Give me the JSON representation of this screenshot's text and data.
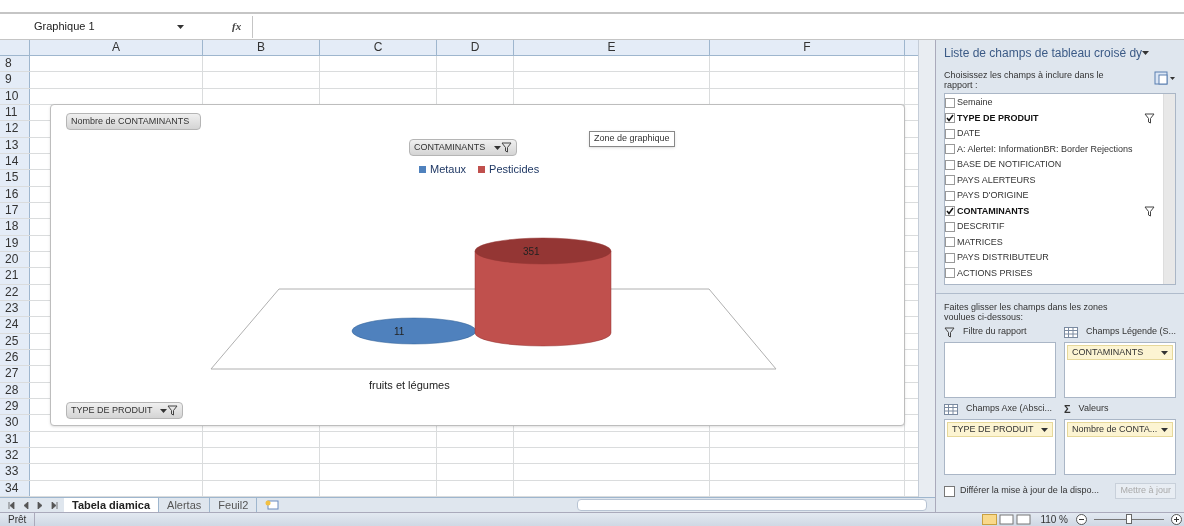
{
  "formula_bar": {
    "name_box": "Graphique 1",
    "fx": "fx"
  },
  "columns": [
    "A",
    "B",
    "C",
    "D",
    "E",
    "F"
  ],
  "rows": [
    "8",
    "9",
    "10",
    "11",
    "12",
    "13",
    "14",
    "15",
    "16",
    "17",
    "18",
    "19",
    "20",
    "21",
    "22",
    "23",
    "24",
    "25",
    "26",
    "27",
    "28",
    "29",
    "30",
    "31",
    "32",
    "33",
    "34"
  ],
  "chart": {
    "value_field": "Nombre de CONTAMINANTS",
    "legend_field": "CONTAMINANTS",
    "axis_field": "TYPE DE PRODUIT",
    "tooltip": "Zone de graphique",
    "category": "fruits et légumes",
    "series": [
      {
        "name": "Metaux",
        "color": "#4f81bd",
        "value_label": "11"
      },
      {
        "name": "Pesticides",
        "color": "#c0504d",
        "value_label": "351"
      }
    ]
  },
  "sheet_tabs": [
    {
      "label": "Tabela diamica",
      "selected": true
    },
    {
      "label": "Alertas",
      "selected": false
    },
    {
      "label": "Feuil2",
      "selected": false
    }
  ],
  "status_bar": {
    "status": "Prêt",
    "zoom": "110 %",
    "zoom_level": {
      "level": 0.5
    }
  },
  "pane": {
    "title": "Liste de champs de tableau croisé dy",
    "choose_text": "Choisissez les champs à inclure dans le rapport :",
    "fields": [
      {
        "label": "Semaine",
        "checked": false,
        "filtered": false
      },
      {
        "label": "TYPE DE PRODUIT",
        "checked": true,
        "filtered": true
      },
      {
        "label": "DATE",
        "checked": false,
        "filtered": false
      },
      {
        "label": "A: AlerteI: InformationBR: Border Rejections",
        "checked": false,
        "filtered": false
      },
      {
        "label": "BASE DE NOTIFICATION",
        "checked": false,
        "filtered": false
      },
      {
        "label": "PAYS ALERTEURS",
        "checked": false,
        "filtered": false
      },
      {
        "label": "PAYS D'ORIGINE",
        "checked": false,
        "filtered": false
      },
      {
        "label": "CONTAMINANTS",
        "checked": true,
        "filtered": true
      },
      {
        "label": "DESCRITIF",
        "checked": false,
        "filtered": false
      },
      {
        "label": "MATRICES",
        "checked": false,
        "filtered": false
      },
      {
        "label": "PAYS DISTRIBUTEUR",
        "checked": false,
        "filtered": false
      },
      {
        "label": "ACTIONS PRISES",
        "checked": false,
        "filtered": false
      }
    ],
    "drag_text": "Faites glisser les champs dans les zones voulues ci-dessous:",
    "zones": [
      {
        "kind": "filter",
        "label": "Filtre du rapport"
      },
      {
        "kind": "legend",
        "label": "Champs Légende (S...",
        "item": "CONTAMINANTS"
      },
      {
        "kind": "axis",
        "label": "Champs Axe (Absci...",
        "item": "TYPE DE PRODUIT"
      },
      {
        "kind": "values",
        "icon": "Σ",
        "label": "Valeurs",
        "item": "Nombre de CONTA..."
      }
    ],
    "defer": {
      "label": "Différer la mise à jour de la dispo...",
      "checked": false
    },
    "update_button": {
      "label": "Mettre à jour",
      "disabled": true
    }
  }
}
